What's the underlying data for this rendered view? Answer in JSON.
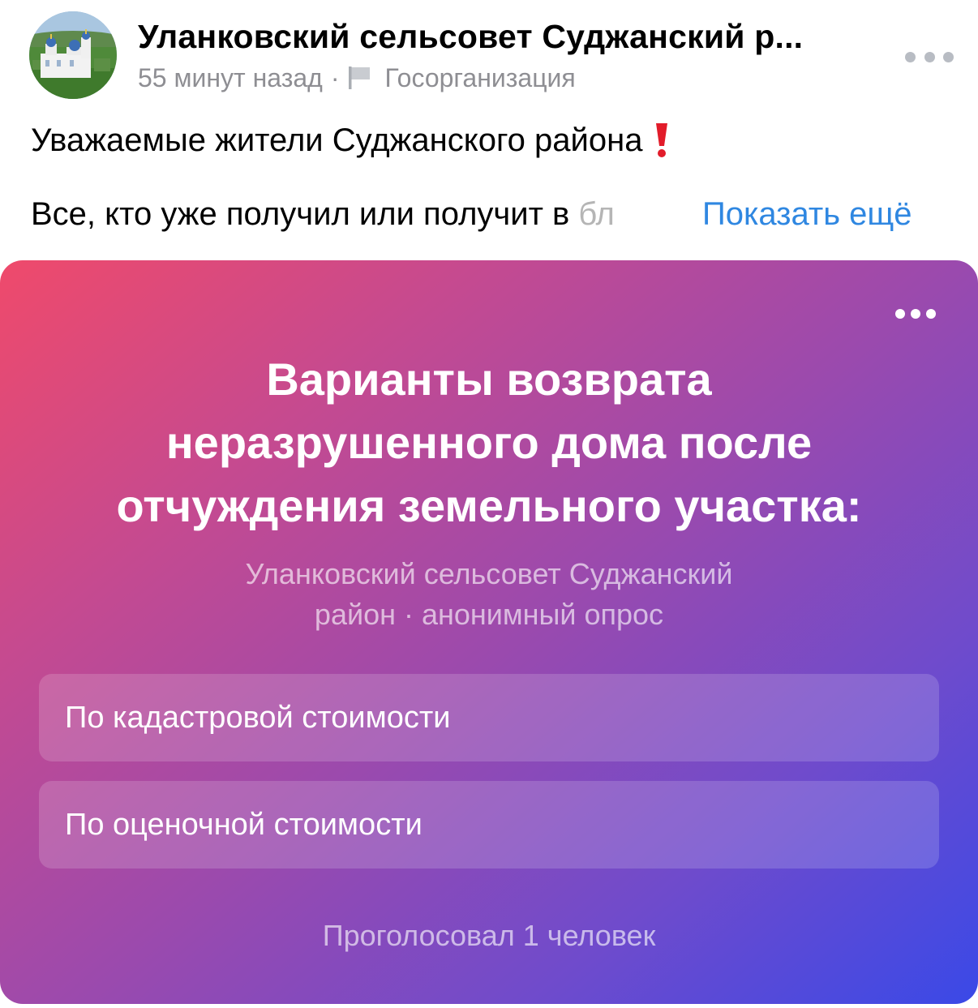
{
  "post": {
    "author_name": "Уланковский сельсовет Суджанский р...",
    "time": "55 минут назад",
    "separator": "·",
    "author_type": "Госорганизация",
    "icons": {
      "avatar": "church-photo-avatar",
      "type": "flag-icon",
      "more": "more-horizontal-icon",
      "emphasis": "red-exclamation-icon"
    },
    "text_line_1": "Уважаемые жители Суджанского района",
    "text_line_2": "Все, кто уже получил или получит в ",
    "text_line_2_fade": "бл",
    "show_more": "Показать ещё"
  },
  "poll": {
    "title_lines": [
      "Варианты возврата",
      "неразрушенного дома после",
      "отчуждения земельного участка:"
    ],
    "subtitle_lines": [
      "Уланковский сельсовет Суджанский",
      "район · анонимный опрос"
    ],
    "options": [
      {
        "label": "По кадастровой стоимости"
      },
      {
        "label": "По оценочной стоимости"
      }
    ],
    "votes": "Проголосовал 1 человек",
    "gradient": [
      "#ef4a6b",
      "#c54a90",
      "#9a4aae",
      "#6f4bcc",
      "#3a49e7"
    ]
  },
  "colors": {
    "link": "#2f87e1",
    "meta": "#8e8e93",
    "exclaim": "#e21c2a"
  }
}
